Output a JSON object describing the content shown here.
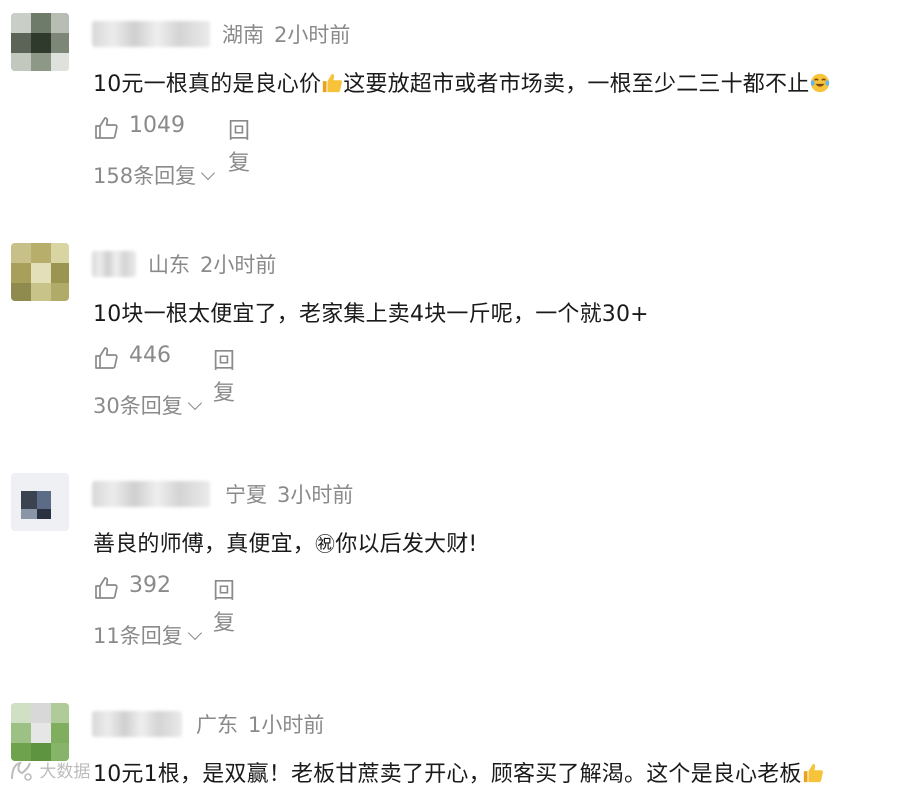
{
  "comments": [
    {
      "region": "湖南",
      "time": "2小时前",
      "text_a": "10元一根真的是良心价",
      "emoji_a": "thumbs-up-emoji",
      "text_b": "这要放超市或者市场卖，一根至少二三十都不止",
      "emoji_b": "laughing-crying-emoji",
      "likes": "1049",
      "reply_label": "回复",
      "replies": "158条回复"
    },
    {
      "region": "山东",
      "time": "2小时前",
      "text": "10块一根太便宜了，老家集上卖4块一斤呢，一个就30+",
      "likes": "446",
      "reply_label": "回复",
      "replies": "30条回复"
    },
    {
      "region": "宁夏",
      "time": "3小时前",
      "text_a": "善良的师傅，真便宜，",
      "emoji_a": "㊗",
      "text_b": "你以后发大财!",
      "likes": "392",
      "reply_label": "回复",
      "replies": "11条回复"
    },
    {
      "region": "广东",
      "time": "1小时前",
      "text_a": "10元1根，是双赢！老板甘蔗卖了开心，顾客买了解渴。这个是良心老板",
      "emoji_a": "thumbs-up-emoji"
    }
  ],
  "watermark": {
    "text": "大数据"
  },
  "colors": {
    "meta": "#8a8a8a",
    "text": "#1a1a1a",
    "thumb": "#f2b233"
  }
}
